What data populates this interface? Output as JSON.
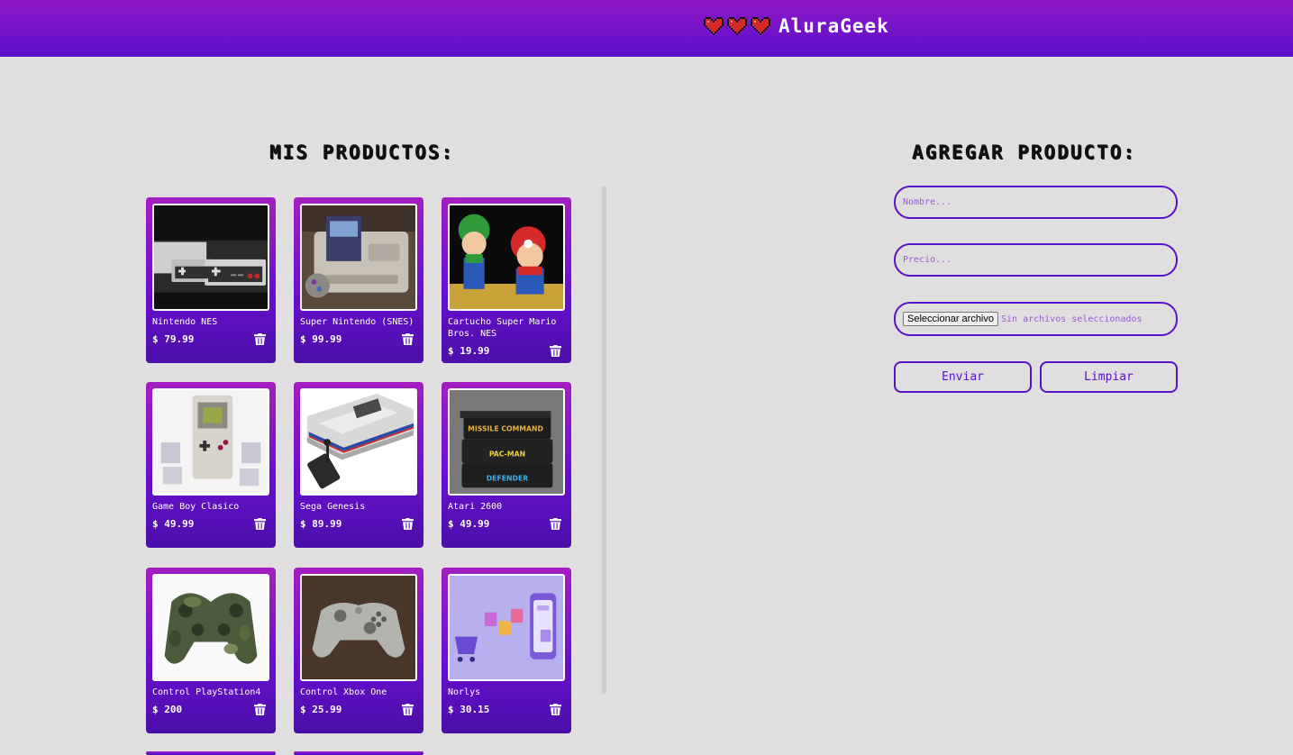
{
  "brand": {
    "name": "AluraGeek",
    "icon": "heart-icon"
  },
  "products_section": {
    "title": "MIS PRODUCTOS:"
  },
  "products": [
    {
      "name": "Nintendo NES",
      "price": "$ 79.99"
    },
    {
      "name": "Super Nintendo (SNES)",
      "price": "$ 99.99"
    },
    {
      "name": "Cartucho Super Mario Bros. NES",
      "price": "$ 19.99"
    },
    {
      "name": "Game Boy Clasico",
      "price": "$ 49.99"
    },
    {
      "name": "Sega Genesis",
      "price": "$ 89.99"
    },
    {
      "name": "Atari 2600",
      "price": "$ 49.99"
    },
    {
      "name": "Control PlayStation4",
      "price": "$ 200"
    },
    {
      "name": "Control Xbox One",
      "price": "$ 25.99"
    },
    {
      "name": "Norlys",
      "price": "$ 30.15"
    }
  ],
  "form": {
    "title": "AGREGAR PRODUCTO:",
    "name_placeholder": "Nombre...",
    "price_placeholder": "Precio...",
    "file_button": "Seleccionar archivo",
    "file_status": "Sin archivos seleccionados",
    "submit_label": "Enviar",
    "clear_label": "Limpiar"
  },
  "colors": {
    "header_start": "#8f18c8",
    "header_end": "#5b0fc9",
    "accent": "#5a12c8",
    "background": "#e0dedf"
  },
  "atari_labels": [
    "MISSILE COMMAND",
    "PAC-MAN",
    "DEFENDER"
  ]
}
